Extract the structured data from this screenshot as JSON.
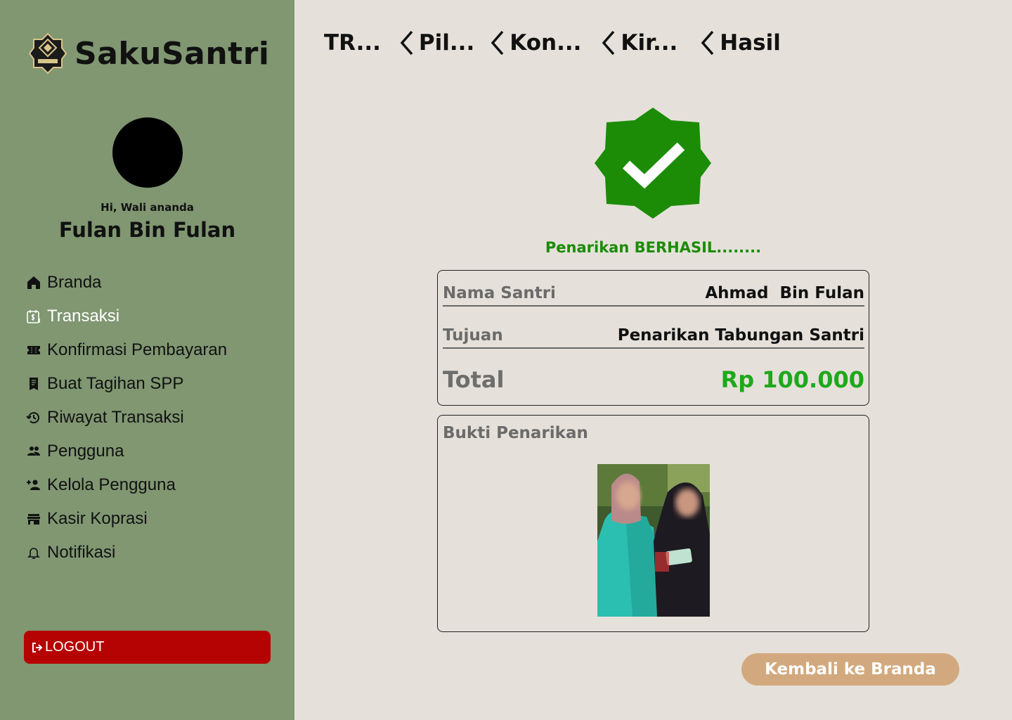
{
  "app": {
    "name": "SakuSantri"
  },
  "user": {
    "greeting": "Hi, Wali ananda",
    "name": "Fulan Bin Fulan"
  },
  "sidebar": {
    "items": [
      {
        "label": "Branda",
        "icon": "home-icon"
      },
      {
        "label": "Transaksi",
        "icon": "receipt-dollar-icon",
        "active": true
      },
      {
        "label": "Konfirmasi Pembayaran",
        "icon": "ticket-icon"
      },
      {
        "label": "Buat Tagihan SPP",
        "icon": "bill-icon"
      },
      {
        "label": "Riwayat Transaksi",
        "icon": "history-icon"
      },
      {
        "label": "Pengguna",
        "icon": "users-icon"
      },
      {
        "label": "Kelola Pengguna",
        "icon": "user-add-icon"
      },
      {
        "label": "Kasir Koprasi",
        "icon": "store-icon"
      },
      {
        "label": "Notifikasi",
        "icon": "bell-icon"
      }
    ],
    "logout_label": "LOGOUT"
  },
  "breadcrumb": [
    "TR...",
    "Pil...",
    "Kon...",
    "Kir...",
    "Hasil"
  ],
  "result": {
    "status_text": "Penarikan BERHASIL........",
    "rows": [
      {
        "label": "Nama Santri",
        "value": "Ahmad  Bin Fulan"
      },
      {
        "label": "Tujuan",
        "value": "Penarikan Tabungan Santri"
      }
    ],
    "total_label": "Total",
    "total_value": "Rp 100.000",
    "proof_title": "Bukti Penarikan"
  },
  "actions": {
    "home_button": "Kembali ke Branda"
  },
  "colors": {
    "sidebar_bg": "#809772",
    "page_bg": "#e5e1da",
    "success_green": "#1c8c06",
    "total_green": "#1ea81c",
    "logout_red": "#b50303",
    "home_button": "#d2a97e"
  }
}
